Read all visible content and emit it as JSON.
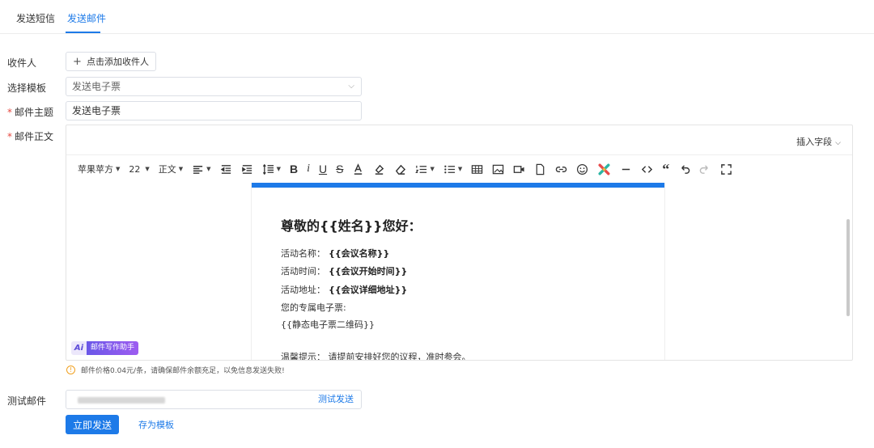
{
  "tabs": [
    {
      "label": "发送短信",
      "active": false
    },
    {
      "label": "发送邮件",
      "active": true
    }
  ],
  "form": {
    "recipients_label": "收件人",
    "add_recipient_label": "点击添加收件人",
    "template_label": "选择模板",
    "template_value": "发送电子票",
    "subject_label": "邮件主题",
    "subject_value": "发送电子票",
    "body_label": "邮件正文",
    "required_mark": "*"
  },
  "editor": {
    "insert_field_label": "插入字段",
    "toolbar": {
      "font_family": "苹果苹方",
      "font_size": "22",
      "paragraph": "正文"
    },
    "icons": [
      "align-left-icon",
      "outdent-icon",
      "indent-icon",
      "line-height-icon",
      "bold-icon",
      "italic-icon",
      "underline-icon",
      "strikethrough-icon",
      "font-color-icon",
      "highlight-icon",
      "eraser-icon",
      "ordered-list-icon",
      "bullet-list-icon",
      "table-icon",
      "image-icon",
      "video-icon",
      "file-icon",
      "link-icon",
      "emoji-icon",
      "plugin-icon",
      "horizontal-rule-icon",
      "code-icon",
      "quote-icon",
      "undo-icon",
      "redo-icon",
      "fullscreen-icon"
    ],
    "doc": {
      "heading": "尊敬的{{姓名}}您好：",
      "rows": [
        {
          "label": "活动名称：",
          "value": "{{会议名称}}"
        },
        {
          "label": "活动时间：",
          "value": "{{会议开始时间}}"
        },
        {
          "label": "活动地址：",
          "value": "{{会议详细地址}}"
        }
      ],
      "ticket_label": "您的专属电子票:",
      "ticket_qr": "{{静态电子票二维码}}",
      "reminder": "温馨提示：  请提前安排好您的议程，准时参会。"
    },
    "ai_icon_text": "Ai",
    "ai_label": "邮件写作助手"
  },
  "price_tip": "邮件价格0.04元/条，请确保邮件余额充足，以免信息发送失败!",
  "test": {
    "label": "测试邮件",
    "send_label": "测试发送"
  },
  "actions": {
    "send_now": "立即发送",
    "save_template": "存为模板"
  },
  "colors": {
    "accent": "#1d7ae8",
    "required": "#e5483f",
    "warning": "#f0a020",
    "ai_gradient_start": "#6a57e8",
    "ai_gradient_end": "#9d5cf0"
  }
}
